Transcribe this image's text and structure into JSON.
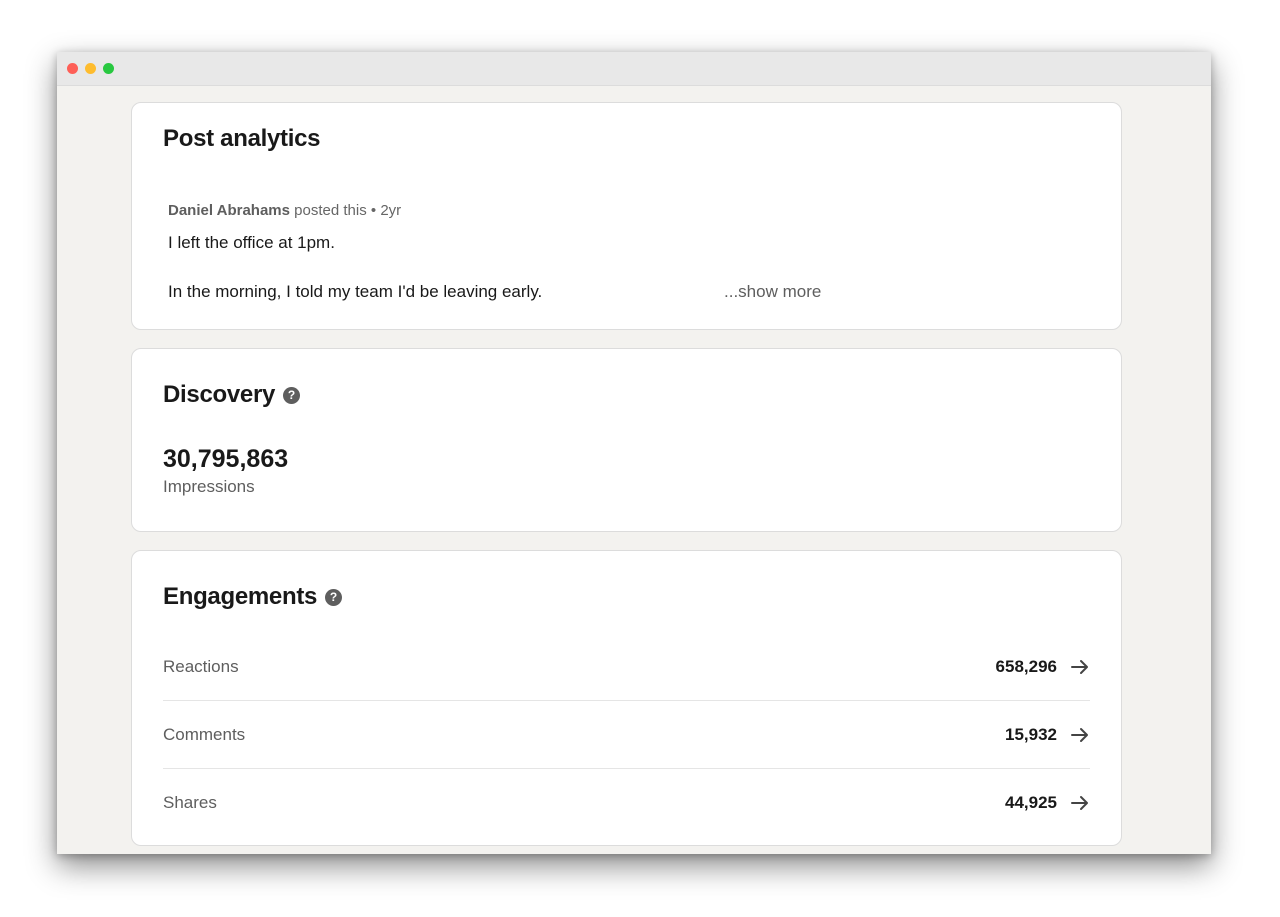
{
  "window": {
    "controls": [
      "close",
      "minimize",
      "maximize"
    ]
  },
  "analytics": {
    "title": "Post analytics",
    "post": {
      "author": "Daniel Abrahams",
      "action": "posted this",
      "separator": "•",
      "age": "2yr",
      "line1": "I left the office at 1pm.",
      "line2": "In the morning, I told my team I'd be leaving early.",
      "show_more": "...show more"
    }
  },
  "discovery": {
    "title": "Discovery",
    "help_icon": "question-circle-icon",
    "impressions_value": "30,795,863",
    "impressions_label": "Impressions"
  },
  "engagements": {
    "title": "Engagements",
    "help_icon": "question-circle-icon",
    "rows": [
      {
        "label": "Reactions",
        "value": "658,296",
        "icon": "arrow-right-icon"
      },
      {
        "label": "Comments",
        "value": "15,932",
        "icon": "arrow-right-icon"
      },
      {
        "label": "Shares",
        "value": "44,925",
        "icon": "arrow-right-icon"
      }
    ]
  },
  "colors": {
    "page_background": "#f3f2ef",
    "card_background": "#ffffff",
    "text_primary": "#191919",
    "text_secondary": "#5e5e5e"
  }
}
